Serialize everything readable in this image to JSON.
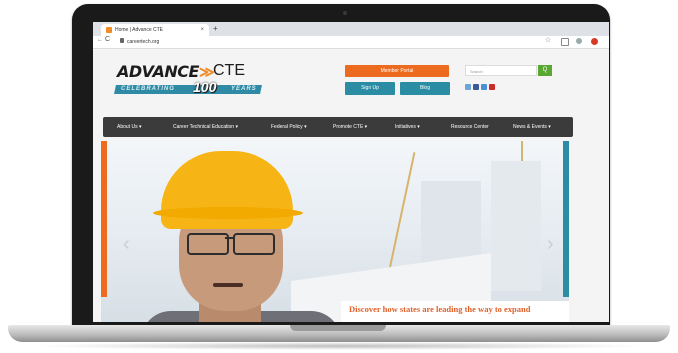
{
  "browser": {
    "tab_title": "Home | Advance CTE",
    "tab_close": "×",
    "new_tab": "+",
    "back": "←",
    "reload": "C",
    "url": "careertech.org",
    "toolbar_icons": [
      "star-icon",
      "extension-icon",
      "profile-icon",
      "menu-icon"
    ]
  },
  "header": {
    "logo": {
      "word1": "ADVANCE",
      "arrow": "≫",
      "word2": "CTE",
      "tagline": "CELEBRATING",
      "number": "100",
      "tagline_end": "YEARS"
    },
    "member_portal_label": "Member Portal",
    "signup_label": "Sign Up",
    "blog_label": "Blog",
    "search_placeholder": "Search",
    "search_button": "Q",
    "social_colors": [
      "#6aa7d8",
      "#3b5998",
      "#4a90d9",
      "#cc2b2b"
    ]
  },
  "nav": {
    "items": [
      "About Us ▾",
      "Career Technical Education ▾",
      "Federal Policy ▾",
      "Promote CTE ▾",
      "Initiatives ▾",
      "Resource Center",
      "News & Events ▾"
    ]
  },
  "hero": {
    "caption": "Discover how states are leading the way to expand",
    "prev": "‹",
    "next": "›"
  },
  "colors": {
    "orange": "#ec6b1e",
    "teal": "#2a8da4",
    "nav_bg": "#3b3b3b",
    "search_green": "#5aa832"
  }
}
